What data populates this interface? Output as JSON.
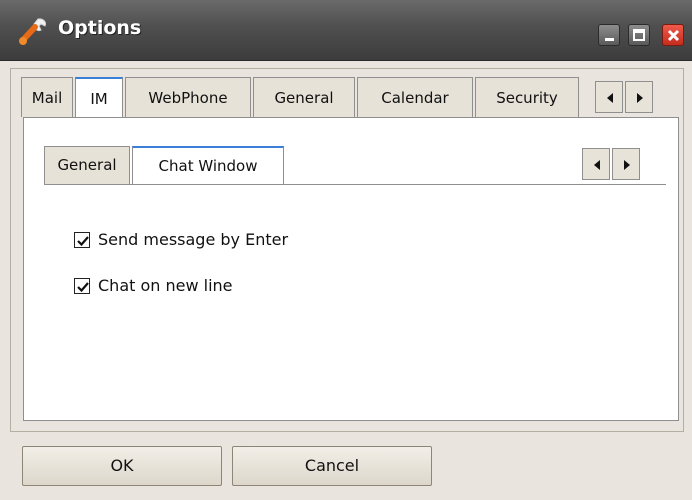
{
  "window": {
    "title": "Options",
    "icon": "wrench-icon"
  },
  "tabs": [
    {
      "label": "Mail"
    },
    {
      "label": "IM",
      "active": true
    },
    {
      "label": "WebPhone"
    },
    {
      "label": "General"
    },
    {
      "label": "Calendar"
    },
    {
      "label": "Security"
    }
  ],
  "subtabs": [
    {
      "label": "General"
    },
    {
      "label": "Chat Window",
      "active": true
    }
  ],
  "options": [
    {
      "label": "Send message by Enter",
      "checked": true
    },
    {
      "label": "Chat on new line",
      "checked": true
    }
  ],
  "buttons": {
    "ok_label": "OK",
    "cancel_label": "Cancel"
  },
  "colors": {
    "accent": "#3c7fd6",
    "close_button": "#d8392a"
  }
}
